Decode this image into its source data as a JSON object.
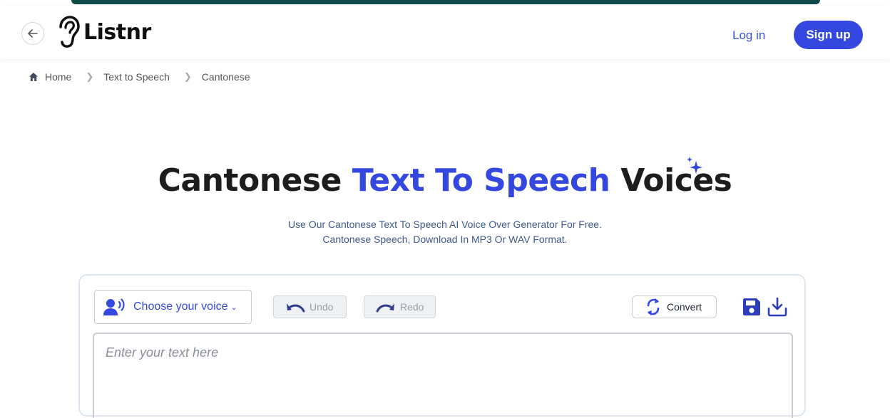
{
  "header": {
    "logo_text": "Listnr",
    "login_label": "Log in",
    "signup_label": "Sign up"
  },
  "breadcrumb": {
    "items": [
      "Home",
      "Text to Speech",
      "Cantonese"
    ]
  },
  "hero": {
    "title_start": "Cantonese ",
    "title_accent": "Text To Speech",
    "title_end": " Voices",
    "subtitle_line1": "Use Our Cantonese Text To Speech AI Voice Over Generator For Free.",
    "subtitle_line2": "Cantonese Speech, Download In MP3 Or WAV Format."
  },
  "editor": {
    "voice_label": "Choose your voice",
    "undo_label": "Undo",
    "redo_label": "Redo",
    "convert_label": "Convert",
    "text_placeholder": "Enter your text here"
  },
  "colors": {
    "accent": "#3448e0",
    "topbar": "#0f4a4a",
    "subtitle": "#3d5a8a"
  }
}
